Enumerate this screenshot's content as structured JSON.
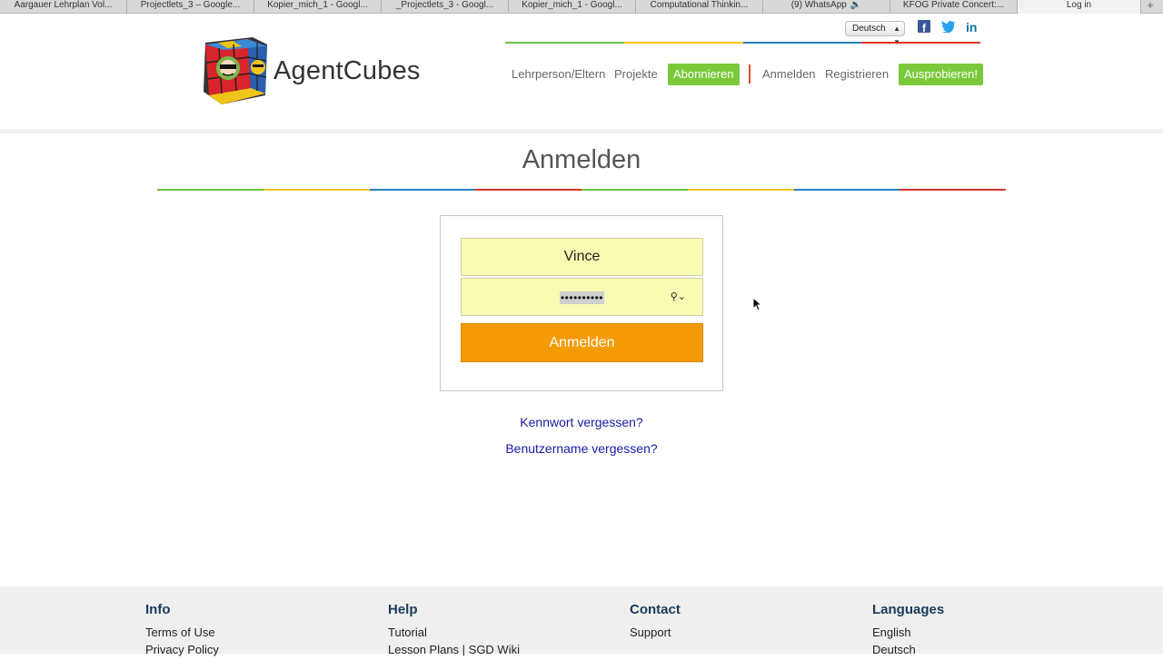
{
  "browser": {
    "tabs": [
      {
        "label": "Aargauer Lehrplan Vol..."
      },
      {
        "label": "Projectlets_3 – Google..."
      },
      {
        "label": "Kopier_mich_1 - Googl..."
      },
      {
        "label": "_Projectlets_3 - Googl..."
      },
      {
        "label": "Kopier_mich_1 - Googl..."
      },
      {
        "label": "Computational Thinkin..."
      },
      {
        "label": "(9) WhatsApp"
      },
      {
        "label": "KFOG Private Concert:..."
      },
      {
        "label": "Log in"
      }
    ],
    "new_tab": "+",
    "speaker_icon": "speaker-icon"
  },
  "header": {
    "brand": "AgentCubes",
    "language": "Deutsch",
    "social": {
      "facebook": "f",
      "twitter": "t",
      "linkedin": "in"
    },
    "nav": {
      "teachers": "Lehrperson/Eltern",
      "projects": "Projekte",
      "subscribe": "Abonnieren",
      "login": "Anmelden",
      "register": "Registrieren",
      "try": "Ausprobieren!"
    }
  },
  "colors": {
    "green": "#7ac93a",
    "orange": "#f39a05",
    "field_bg": "#f7fbb3",
    "link": "#1a1aa6"
  },
  "main": {
    "title": "Anmelden",
    "username_value": "Vince",
    "password_dots": "••••••••••",
    "submit_label": "Anmelden",
    "forgot_password": "Kennwort vergessen?",
    "forgot_username": "Benutzername vergessen?"
  },
  "footer": {
    "info": {
      "title": "Info",
      "items": [
        "Terms of Use",
        "Privacy Policy"
      ]
    },
    "help": {
      "title": "Help",
      "items": [
        "Tutorial",
        "Lesson Plans | SGD Wiki"
      ]
    },
    "contact": {
      "title": "Contact",
      "items": [
        "Support"
      ]
    },
    "languages": {
      "title": "Languages",
      "items": [
        "English",
        "Deutsch"
      ]
    }
  }
}
